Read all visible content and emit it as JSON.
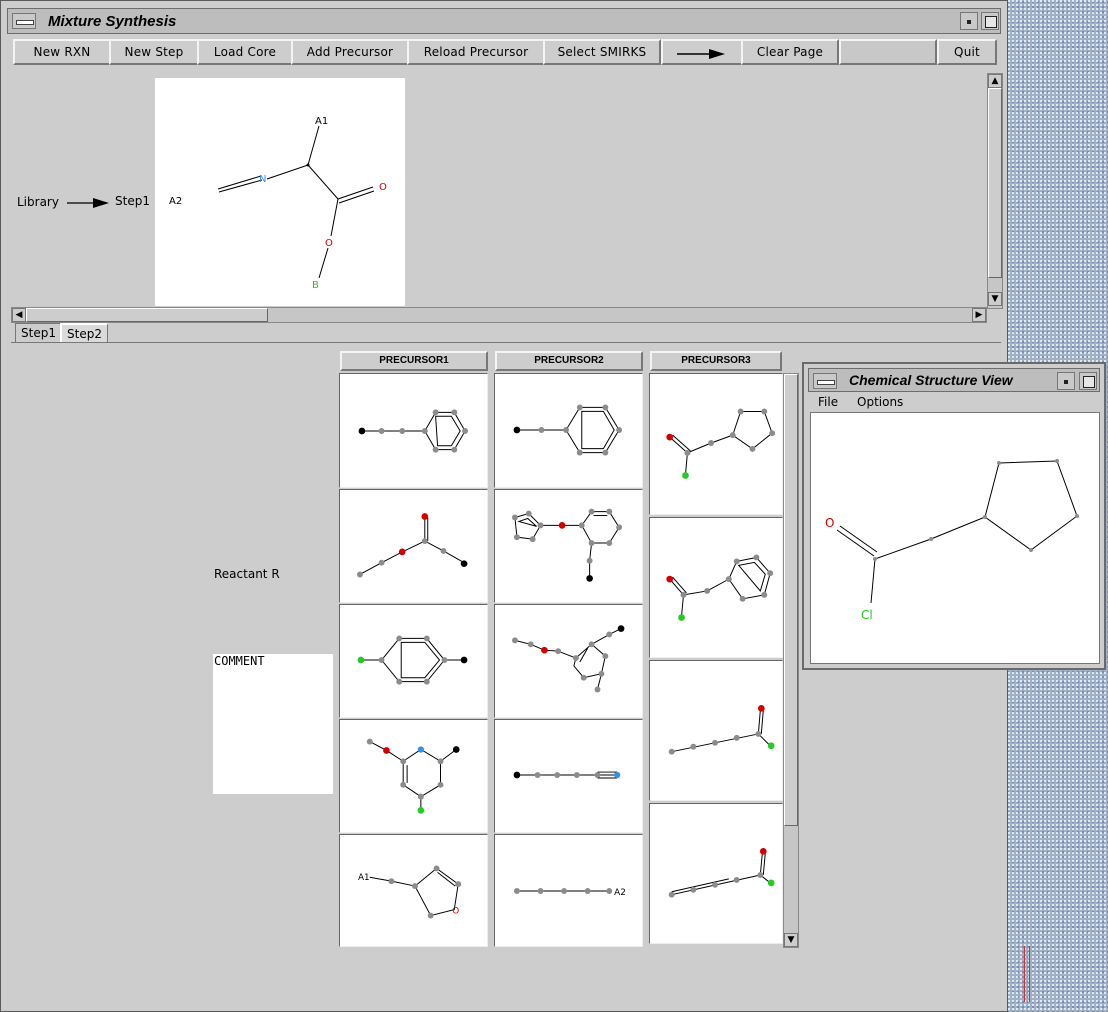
{
  "window": {
    "title": "Mixture Synthesis",
    "toolbar": {
      "new_rxn": "New RXN",
      "new_step": "New Step",
      "load_core": "Load Core",
      "add_precursor": "Add Precursor",
      "reload_precursor": "Reload Precursor",
      "select_smirks": "Select SMIRKS",
      "clear_page": "Clear Page",
      "quit": "Quit"
    },
    "top_panel": {
      "library_label": "Library",
      "step_label": "Step1",
      "core_atoms": {
        "a1": "A1",
        "a2": "A2",
        "n": "N",
        "o_double": "O",
        "o_single": "O",
        "b": "B"
      }
    },
    "tabs": [
      "Step1",
      "Step2"
    ],
    "active_tab": "Step2",
    "reactant_label": "Reactant R",
    "comment_label": "COMMENT",
    "columns": [
      "PRECURSOR1",
      "PRECURSOR2",
      "PRECURSOR3"
    ],
    "atom_labels": {
      "a1": "A1",
      "a2": "A2",
      "o": "O"
    }
  },
  "chem_view": {
    "title": "Chemical Structure View",
    "menu": {
      "file": "File",
      "options": "Options"
    },
    "atoms": {
      "o": "O",
      "cl": "Cl"
    }
  },
  "colors": {
    "oxygen": "#d40000",
    "halogen": "#22cc22",
    "nitrogen": "#3a8ee6",
    "carbon": "#8c8c8c",
    "anchor": "#000000"
  }
}
